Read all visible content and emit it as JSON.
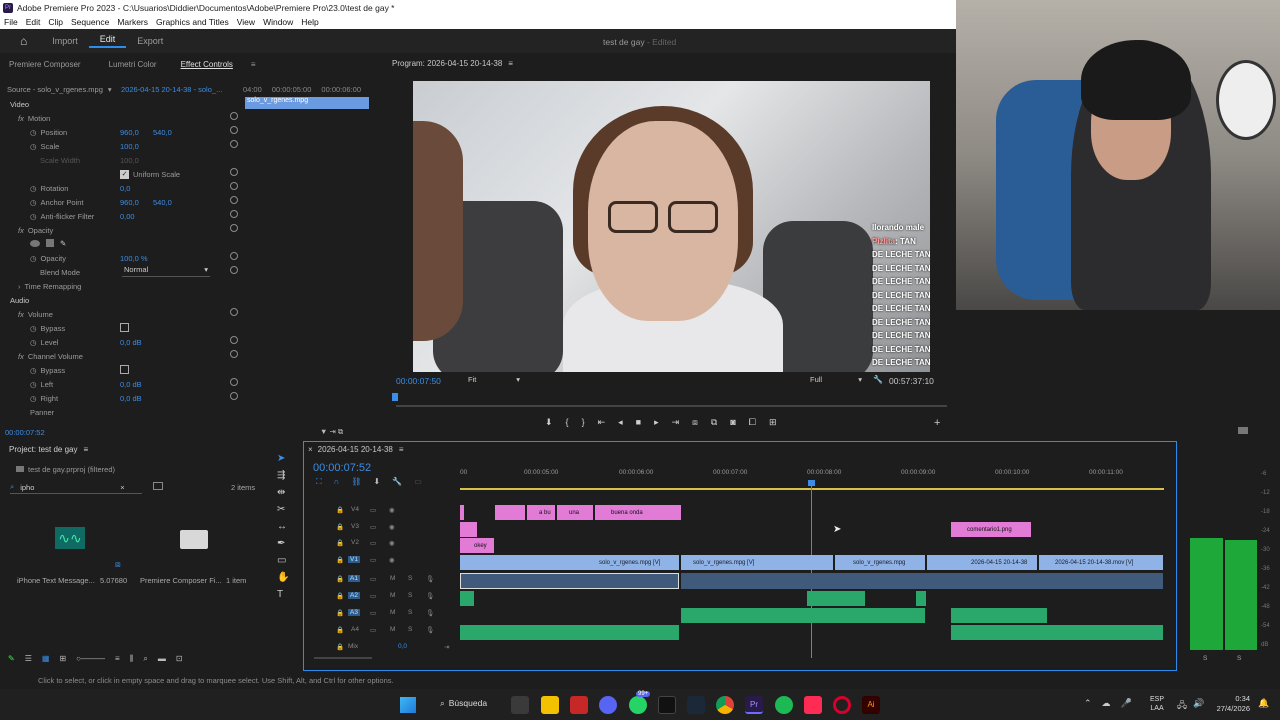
{
  "window": {
    "title": "Adobe Premiere Pro 2023 - C:\\Usuarios\\Diddier\\Documentos\\Adobe\\Premiere Pro\\23.0\\test de gay *"
  },
  "menu": [
    "File",
    "Edit",
    "Clip",
    "Sequence",
    "Markers",
    "Graphics and Titles",
    "View",
    "Window",
    "Help"
  ],
  "workspace": {
    "tabs": [
      "Import",
      "Edit",
      "Export"
    ],
    "active": "Edit",
    "doc_title": "test de gay",
    "doc_status": "Edited"
  },
  "effect_controls": {
    "tabs": [
      "Premiere Composer",
      "Lumetri Color",
      "Effect Controls"
    ],
    "source": "Source - solo_v_rgenes.mpg",
    "sequence": "2026-04-15 20-14-38 - solo_...",
    "ruler": [
      "04:00",
      "00:00:05:00",
      "00:00:06:00"
    ],
    "clip_label": "solo_v_rgenes.mpg",
    "section_video": "Video",
    "motion": "Motion",
    "rows": [
      {
        "label": "Position",
        "v1": "960,0",
        "v2": "540,0"
      },
      {
        "label": "Scale",
        "v1": "100,0",
        "v2": ""
      },
      {
        "label": "Scale Width",
        "v1": "100,0",
        "v2": ""
      },
      {
        "label": "Uniform Scale",
        "v1": "",
        "v2": ""
      },
      {
        "label": "Rotation",
        "v1": "0,0",
        "v2": ""
      },
      {
        "label": "Anchor Point",
        "v1": "960,0",
        "v2": "540,0"
      },
      {
        "label": "Anti-flicker Filter",
        "v1": "0,00",
        "v2": ""
      }
    ],
    "opacity": "Opacity",
    "opacity_value": "100,0 %",
    "blend_mode_label": "Blend Mode",
    "blend_mode": "Normal",
    "time_remapping": "Time Remapping",
    "section_audio": "Audio",
    "volume": "Volume",
    "bypass": "Bypass",
    "level": "Level",
    "level_value": "0,0 dB",
    "channel_volume": "Channel Volume",
    "left": "Left",
    "left_value": "0,0 dB",
    "right": "Right",
    "right_value": "0,0 dB",
    "panner": "Panner",
    "timecode": "00:00:07:52"
  },
  "program": {
    "title": "Program: 2026-04-15 20-14-38",
    "timecode": "00:00:07:50",
    "fit": "Fit",
    "quality": "Full",
    "duration": "00:57:37:10",
    "chat": {
      "header": "llorando male",
      "user": "Pizlita",
      "first": ": TAN",
      "lines": [
        "DE LECHE TAN",
        "DE LECHE TAN",
        "DE LECHE TAN",
        "DE LECHE TAN",
        "DE LECHE TAN",
        "DE LECHE TAN",
        "DE LECHE TAN",
        "DE LECHE TAN",
        "DE LECHE TAN"
      ]
    }
  },
  "project": {
    "title": "Project: test de gay",
    "file": "test de gay.prproj (filtered)",
    "search": "ipho",
    "items_count": "2 items",
    "items": [
      {
        "name": "iPhone Text Message...",
        "duration": "5.07680"
      },
      {
        "name": "Premiere Composer Fi...",
        "duration": "1 item"
      }
    ]
  },
  "timeline": {
    "sequence": "2026-04-15 20-14-38",
    "timecode": "00:00:07:52",
    "ruler": [
      "00",
      "00:00:05:00",
      "00:00:06:00",
      "00:00:07:00",
      "00:00:08:00",
      "00:00:09:00",
      "00:00:10:00",
      "00:00:11:00"
    ],
    "tracks": [
      "V4",
      "V3",
      "V2",
      "V1",
      "A1",
      "A2",
      "A3",
      "A4"
    ],
    "mix_label": "Mix",
    "mix_value": "0,0",
    "clips": {
      "v4": [
        "a bu",
        "una",
        "buena onda"
      ],
      "v3": [
        "comentario1.png"
      ],
      "v2": [
        "okey"
      ],
      "v1": [
        "solo_v_rgenes.mpg [V]",
        "solo_v_rgenes.mpg [V]",
        "solo_v_rgenes.mpg",
        "2026-04-15 20-14-38",
        "2026-04-15 20-14-38.mov [V]"
      ]
    }
  },
  "meters": {
    "labels": [
      "-6",
      "-12",
      "-18",
      "-24",
      "-30",
      "-36",
      "-42",
      "-48",
      "-54",
      "dB"
    ],
    "solo": [
      "S",
      "S"
    ],
    "level_left": 0.83,
    "level_right": 0.84
  },
  "status": "Click to select, or click in empty space and drag to marquee select. Use Shift, Alt, and Ctrl for other options.",
  "taskbar": {
    "search": "Búsqueda",
    "lang": "ESP",
    "region": "LAA",
    "time": "0:34",
    "date": "27/4/2026",
    "badge": "99+"
  }
}
